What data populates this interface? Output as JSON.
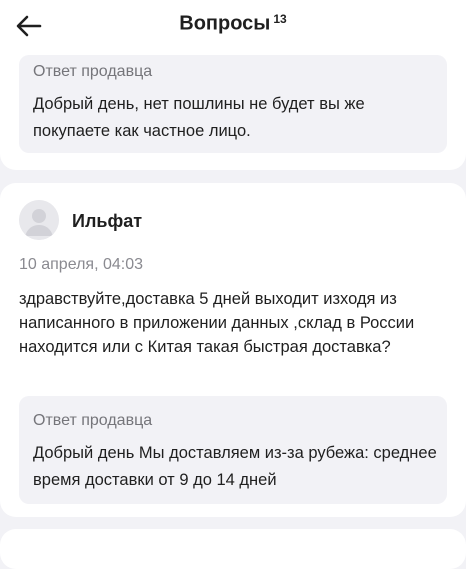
{
  "header": {
    "title": "Вопросы",
    "count": "13",
    "back_icon": "arrow-left-icon"
  },
  "questions": [
    {
      "answer": {
        "label": "Ответ продавца",
        "text": "Добрый день, нет пошлины не будет вы же покупаете как частное лицо."
      }
    },
    {
      "author": "Ильфат",
      "avatar_icon": "user-avatar-icon",
      "date": "10 апреля, 04:03",
      "text": "здравствуйте,доставка 5 дней выходит изходя из написанного в приложении данных ,склад в России находится или с Китая такая быстрая доставка?",
      "answer": {
        "label": "Ответ продавца",
        "text": "Добрый день Мы доставляем из-за рубежа: среднее время доставки от 9 до 14 дней"
      }
    }
  ],
  "colors": {
    "background": "#f2f2f6",
    "card": "#ffffff",
    "answer_bg": "#f2f2f6",
    "muted_text": "#75757a",
    "date_text": "#8a8a90"
  }
}
